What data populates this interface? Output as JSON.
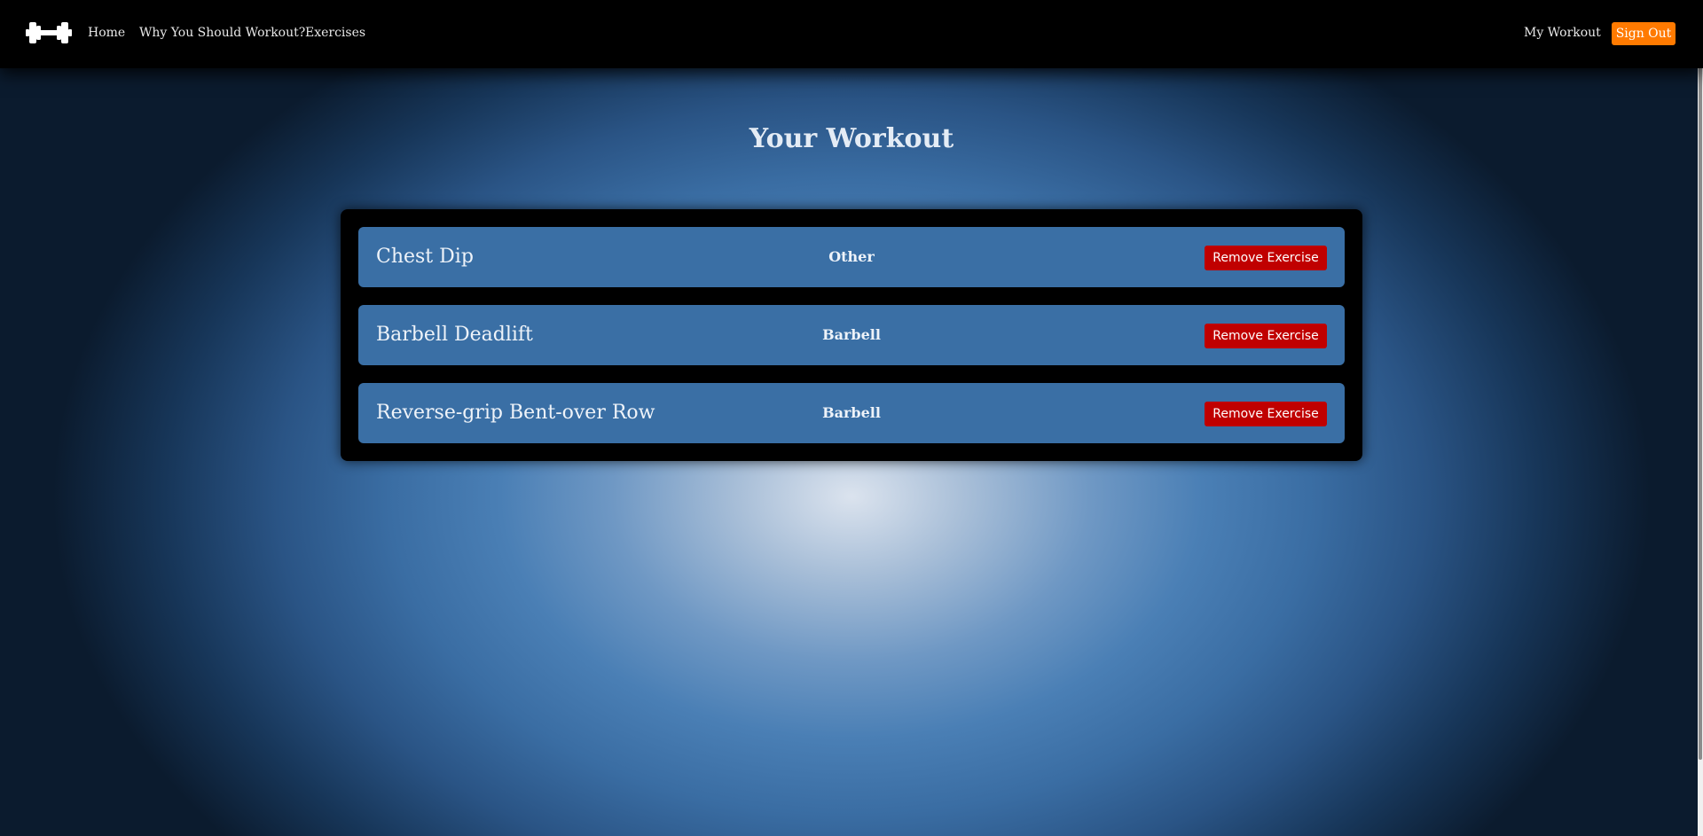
{
  "nav": {
    "logo_icon": "dumbbell-icon",
    "links": [
      "Home",
      "Why You Should Workout?",
      "Exercises"
    ],
    "my_workout": "My Workout",
    "sign_out": "Sign Out",
    "sign_out_color": "#ff7a00"
  },
  "page": {
    "title": "Your Workout"
  },
  "exercises": [
    {
      "name": "Chest Dip",
      "equipment": "Other",
      "action": "Remove Exercise"
    },
    {
      "name": "Barbell Deadlift",
      "equipment": "Barbell",
      "action": "Remove Exercise"
    },
    {
      "name": "Reverse-grip Bent-over Row",
      "equipment": "Barbell",
      "action": "Remove Exercise"
    }
  ],
  "colors": {
    "topbar": "#000000",
    "row": "#3a6fa5",
    "remove_button": "#c00000"
  }
}
